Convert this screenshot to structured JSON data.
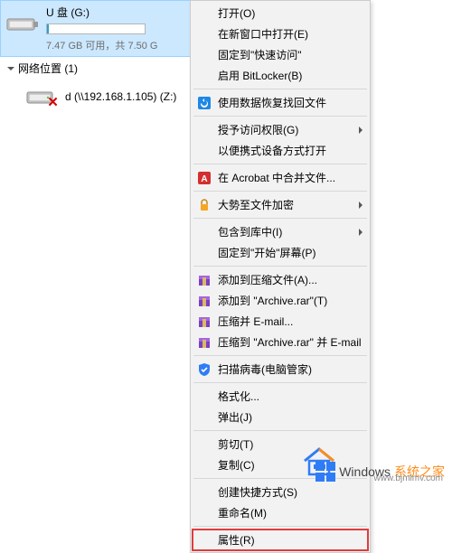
{
  "drive": {
    "name": "U 盘 (G:)",
    "capacity_text": "7.47 GB 可用，共 7.50 G",
    "fill_percent": 2
  },
  "network_section": {
    "title": "网络位置 (1)"
  },
  "network_drive": {
    "label": "d (\\\\192.168.1.105) (Z:)"
  },
  "menu": {
    "open": "打开(O)",
    "open_new_window": "在新窗口中打开(E)",
    "pin_quick_access": "固定到\"快速访问\"",
    "bitlocker": "启用 BitLocker(B)",
    "data_recovery": "使用数据恢复找回文件",
    "grant_access": "授予访问权限(G)",
    "open_portable": "以便携式设备方式打开",
    "acrobat_merge": "在 Acrobat 中合并文件...",
    "encrypt": "大勢至文件加密",
    "include_library": "包含到库中(I)",
    "pin_start": "固定到\"开始\"屏幕(P)",
    "add_archive": "添加到压缩文件(A)...",
    "add_archive_rar": "添加到 \"Archive.rar\"(T)",
    "compress_email": "压缩并 E-mail...",
    "compress_rar_email": "压缩到 \"Archive.rar\" 并 E-mail",
    "scan_virus": "扫描病毒(电脑管家)",
    "format": "格式化...",
    "eject": "弹出(J)",
    "cut": "剪切(T)",
    "copy": "复制(C)",
    "create_shortcut": "创建快捷方式(S)",
    "rename": "重命名(M)",
    "properties": "属性(R)"
  },
  "watermark": {
    "brand": "Windows",
    "cn": "系统之家",
    "url": "www.bjmlmv.com"
  }
}
